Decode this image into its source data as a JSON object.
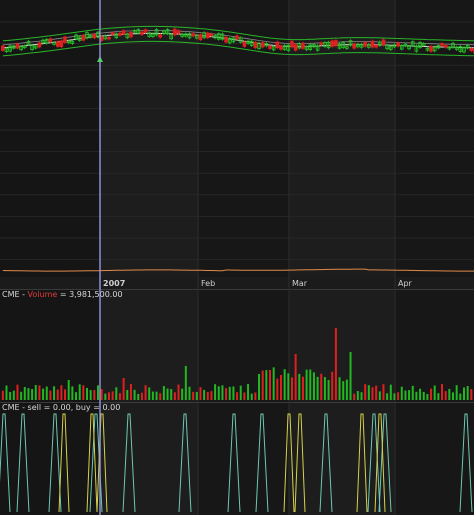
{
  "chart_data": [
    {
      "type": "candlestick",
      "panel": "price",
      "x_labels": [
        "2007",
        "Feb",
        "Mar",
        "Apr"
      ],
      "grid": true,
      "colors": {
        "up": "#22c222",
        "down": "#e02020",
        "bands": "#29b629",
        "average": "#e6e6e6",
        "volume_line": "#e08a4a",
        "cursor": "#9a9ae6",
        "signal_marker": "#33dd33"
      }
    },
    {
      "type": "bar",
      "panel": "volume",
      "symbol": "CME",
      "series_name": "Volume",
      "value_text": "3,981,500.00",
      "colors": {
        "up": "#22b822",
        "down": "#e02020"
      }
    },
    {
      "type": "line",
      "panel": "signals",
      "symbol": "CME",
      "series": [
        {
          "name": "sell",
          "value_text": "0.00",
          "color": "#6ec8b4"
        },
        {
          "name": "buy",
          "value_text": "0.00",
          "color": "#d6d24a"
        }
      ]
    }
  ]
}
